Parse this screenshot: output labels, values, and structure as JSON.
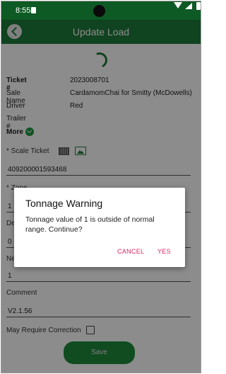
{
  "status_bar": {
    "time": "8:55"
  },
  "app_bar": {
    "title": "Update Load",
    "back_icon": "back-arrow-icon"
  },
  "details": {
    "ticket_label": "Ticket #",
    "ticket_value": "2023008701",
    "sale_label": "Sale Name",
    "sale_value": "CardamomChai for Smitty (McDowells)",
    "driver_label": "Driver",
    "driver_value": "Red",
    "trailer_label": "Trailer #",
    "trailer_value": "",
    "more_label": "More"
  },
  "form": {
    "scale_ticket_label": "* Scale Ticket",
    "scale_ticket_value": "409200001593468",
    "zone_label": "* Zone",
    "zone_value": "1",
    "de_label": "De",
    "de_value": "0",
    "ne_label": "Ne",
    "ne_value": "1",
    "comment_label": "Comment",
    "comment_value": "V2.1.56",
    "correction_label": "May Require Correction",
    "correction_checked": false,
    "save_label": "Save"
  },
  "dialog": {
    "title": "Tonnage Warning",
    "message": "Tonnage value of 1 is outside of normal range. Continue?",
    "cancel_label": "CANCEL",
    "yes_label": "YES"
  },
  "colors": {
    "status_bar": "#0d5a24",
    "app_bar": "#1e7a3a",
    "accent": "#1e8a3a",
    "dialog_button": "#e0266a"
  }
}
